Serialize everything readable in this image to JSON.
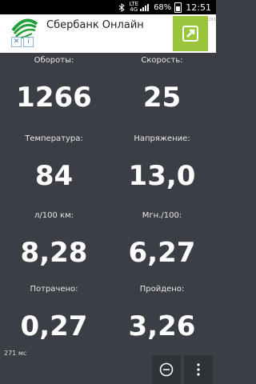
{
  "status_bar": {
    "network": "LTE",
    "network_sub": "4G",
    "battery_percent": "68%",
    "time": "12:51"
  },
  "ad": {
    "title": "Сбербанк Онлайн",
    "tag": "2X1",
    "brand_color": "#21a038",
    "open_button_color": "#9bc53d",
    "badge_close": "✕",
    "badge_info": "i"
  },
  "metrics": [
    {
      "label": "Обороты:",
      "value": "1266"
    },
    {
      "label": "Скорость:",
      "value": "25"
    },
    {
      "label": "Температура:",
      "value": "84"
    },
    {
      "label": "Напряжение:",
      "value": "13,0"
    },
    {
      "label": "л/100 км:",
      "value": "8,28"
    },
    {
      "label": "Мгн./100:",
      "value": "6,27"
    },
    {
      "label": "Потрачено:",
      "value": "0,27"
    },
    {
      "label": "Пройдено:",
      "value": "3,26"
    }
  ],
  "footer": {
    "latency": "271 мс"
  },
  "buttons": {
    "minus_icon": "minus-circle-icon",
    "menu_icon": "more-vertical-icon"
  },
  "colors": {
    "background": "#3b3f45",
    "text": "#ffffff"
  }
}
